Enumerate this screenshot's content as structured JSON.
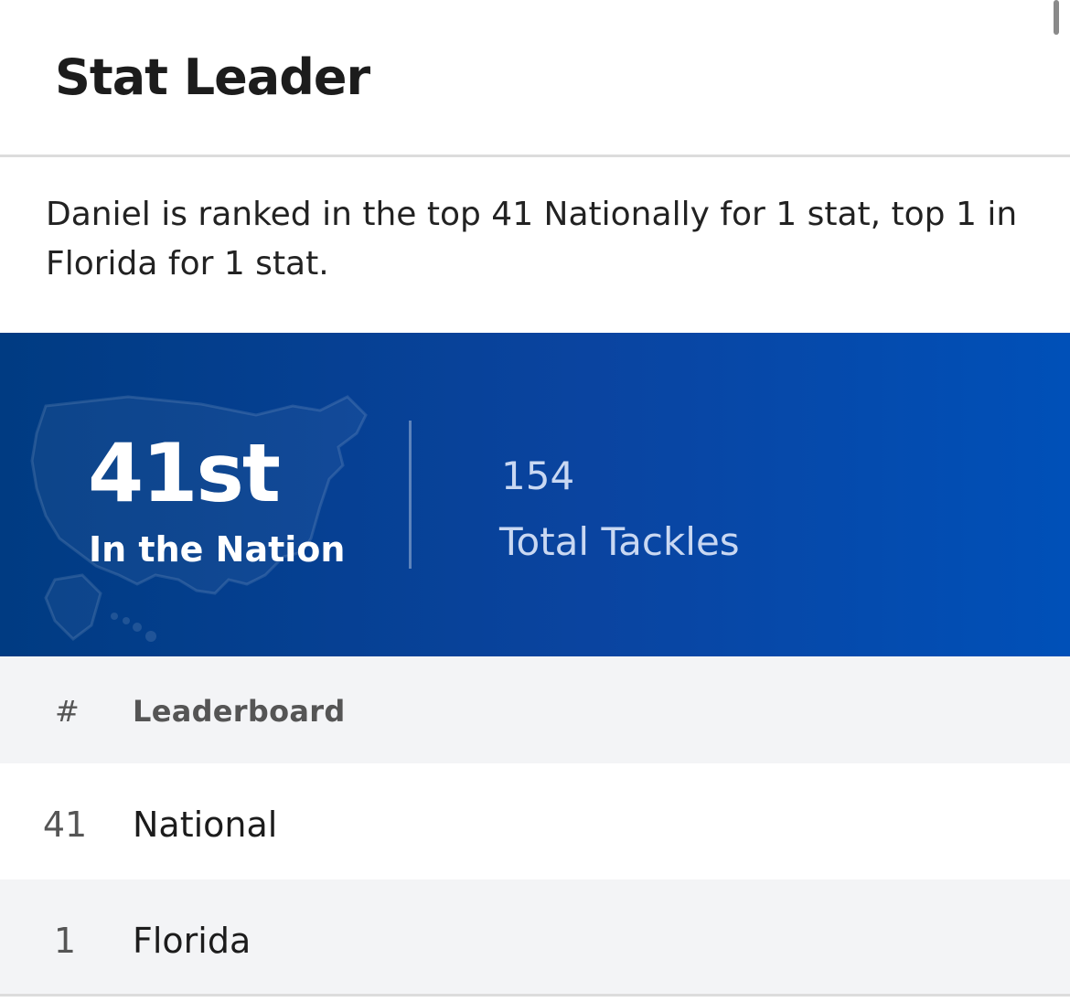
{
  "header": {
    "title": "Stat Leader"
  },
  "summary": {
    "text": "Daniel is ranked in the top 41 Nationally for 1 stat, top 1 in Florida for 1 stat."
  },
  "banner": {
    "rank_value": "41st",
    "rank_label": "In the Nation",
    "stat_value": "154",
    "stat_label": "Total Tackles",
    "background_colors": [
      "#003b82",
      "#0050b8"
    ],
    "map_icon": "usa-map-icon"
  },
  "leaderboard": {
    "columns": [
      "#",
      "Leaderboard"
    ],
    "rows": [
      {
        "rank": "41",
        "name": "National"
      },
      {
        "rank": "1",
        "name": "Florida"
      }
    ]
  }
}
